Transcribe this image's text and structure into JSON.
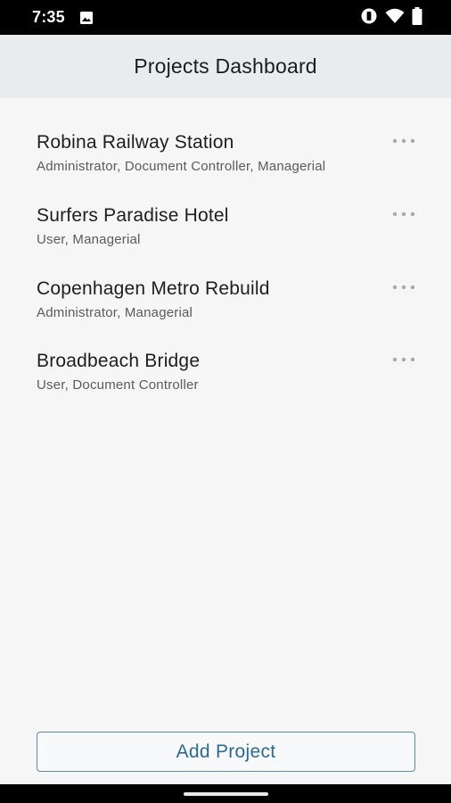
{
  "status_bar": {
    "time": "7:35",
    "icons": [
      "image-icon",
      "vibrate-icon",
      "wifi-icon",
      "battery-icon"
    ]
  },
  "header": {
    "title": "Projects Dashboard"
  },
  "projects": [
    {
      "name": "Robina Railway Station",
      "roles": "Administrator, Document Controller, Managerial"
    },
    {
      "name": "Surfers Paradise Hotel",
      "roles": "User, Managerial"
    },
    {
      "name": "Copenhagen Metro Rebuild",
      "roles": "Administrator, Managerial"
    },
    {
      "name": "Broadbeach Bridge",
      "roles": "User, Document Controller"
    }
  ],
  "footer": {
    "add_label": "Add Project"
  },
  "colors": {
    "background": "#f6f6f7",
    "app_bar": "#e9ebec",
    "accent": "#2c6a94",
    "button_border": "#5f8aa0"
  }
}
